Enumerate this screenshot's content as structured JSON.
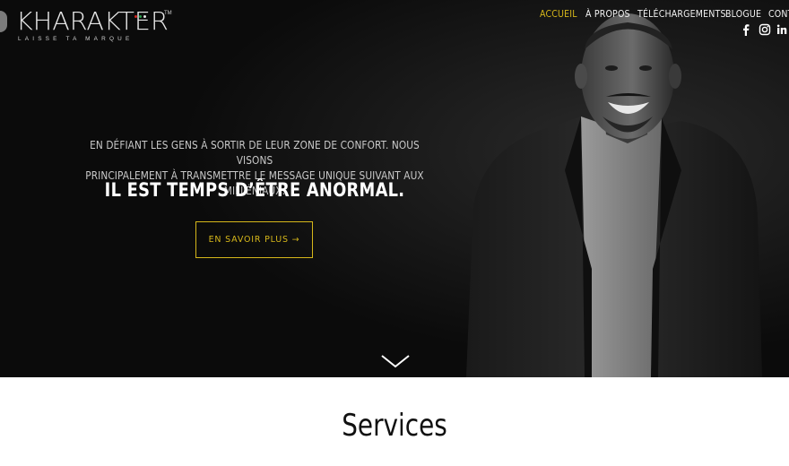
{
  "logo": {
    "wordmark": "KHARAKTER",
    "trademark": "TM",
    "tagline": "LAISSE TA MARQUE",
    "dot_colors": [
      "#d6281f",
      "#2aa14a",
      "#e6e6e6"
    ]
  },
  "nav": {
    "items": [
      {
        "label": "ACCUEIL",
        "active": true
      },
      {
        "label": "À PROPOS",
        "active": false
      },
      {
        "label": "TÉLÉCHARGEMENTS",
        "active": false
      },
      {
        "label": "BLOGUE",
        "active": false
      },
      {
        "label": "CONT",
        "active": false
      }
    ]
  },
  "socials": [
    "facebook-icon",
    "instagram-icon",
    "linkedin-icon"
  ],
  "hero": {
    "subtitle_line1": "EN DÉFIANT LES GENS À SORTIR DE LEUR ZONE DE CONFORT. NOUS VISONS",
    "subtitle_line2": "PRINCIPALEMENT À TRANSMETTRE LE MESSAGE UNIQUE SUIVANT AUX MILLÉNIAUX:",
    "headline": "IL EST TEMPS D’ÊTRE ANORMAL.",
    "cta_label": "EN SAVOIR PLUS →",
    "scroll_icon": "chevron-down-icon"
  },
  "services": {
    "heading": "Services"
  },
  "colors": {
    "accent": "#d6b71a",
    "hero_bg": "#0b0b0b",
    "page_bg": "#ffffff"
  }
}
